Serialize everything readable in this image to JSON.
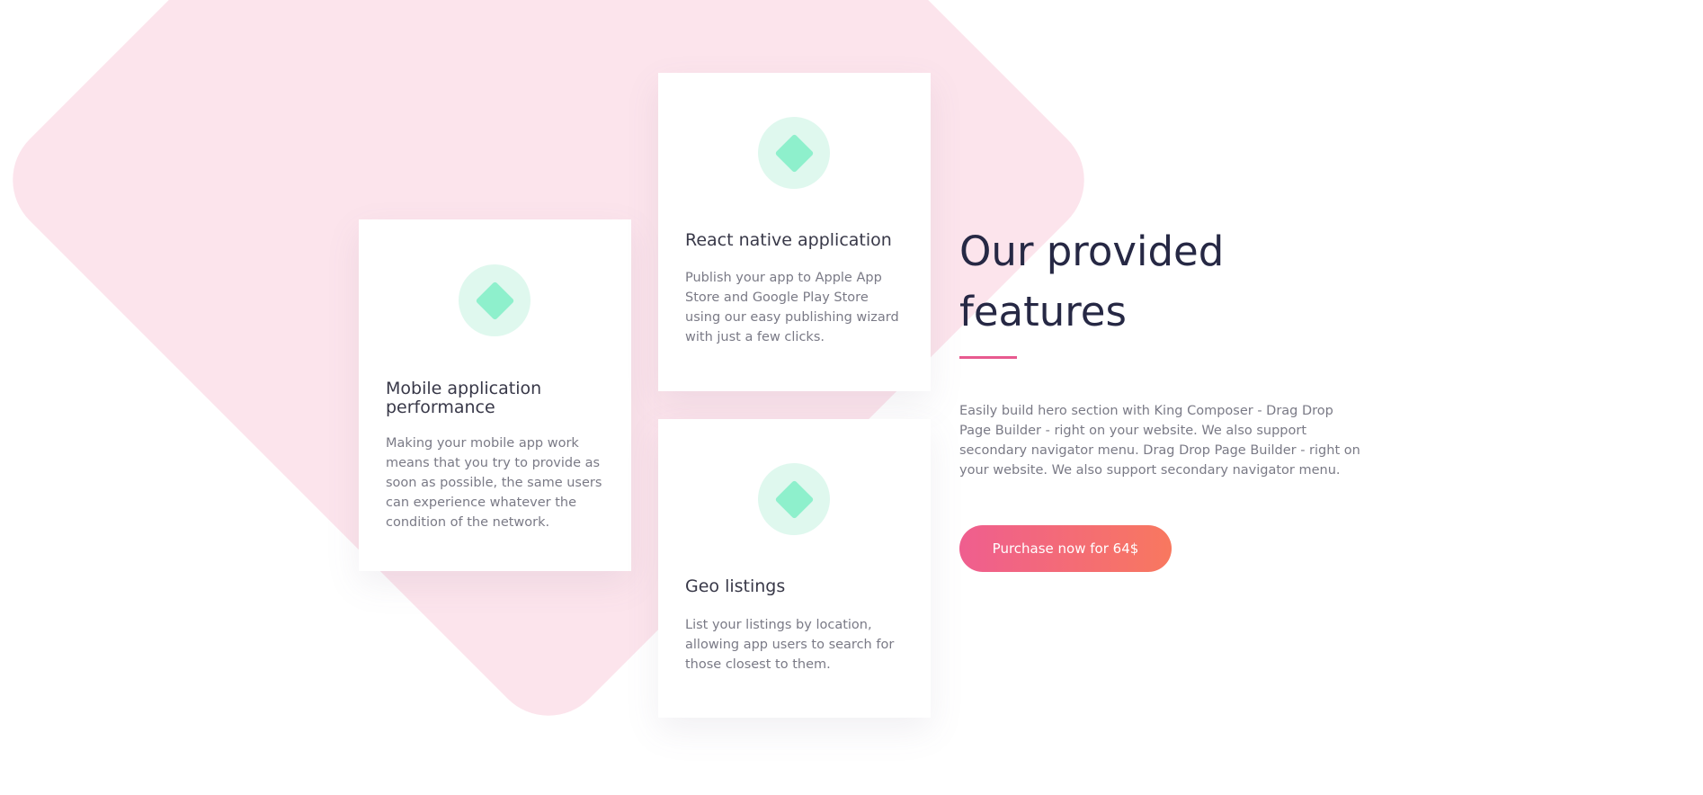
{
  "features": {
    "heading": "Our provided features",
    "description": "Easily build hero section with King Composer - Drag Drop Page Builder - right on your website. We also support secondary navigator menu. Drag Drop Page Builder - right on your website. We also support secondary navigator menu.",
    "purchase_button": "Purchase now for 64$",
    "cards": [
      {
        "title": "Mobile application performance",
        "text": "Making your mobile app work means that you try to provide as soon as possible, the same users can experience whatever the condition of the network.",
        "icon": "diamond-icon"
      },
      {
        "title": "React native application",
        "text": "Publish your app to Apple App Store and Google Play Store using our easy publishing wizard with just a few clicks.",
        "icon": "diamond-icon"
      },
      {
        "title": "Geo listings",
        "text": "List your listings by location, allowing app users to search for those closest to them.",
        "icon": "diamond-icon"
      }
    ]
  },
  "colors": {
    "background_shape": "#fce4ec",
    "icon_circle": "#dff8ee",
    "icon_diamond": "#8ef0cc",
    "accent": "#e85a8f",
    "button_gradient_start": "#ef5e8f",
    "button_gradient_end": "#f8785f",
    "heading": "#262844",
    "body_text": "#7a7a86"
  }
}
